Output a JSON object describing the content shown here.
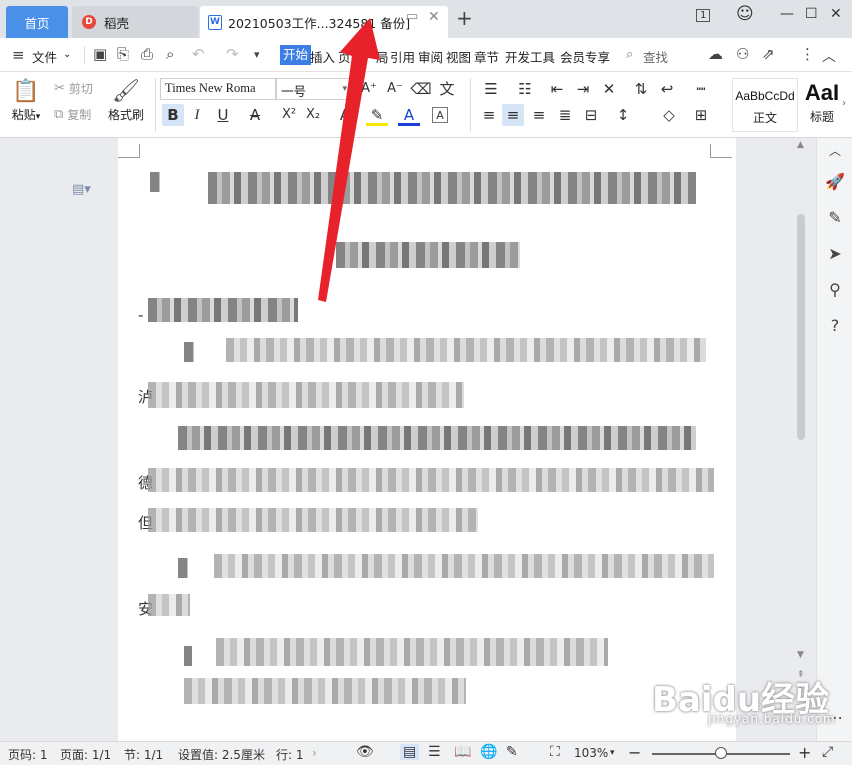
{
  "tabs": {
    "home": "首页",
    "daoke": "稻壳",
    "doc": "20210503工作...324581 备份]"
  },
  "menu": {
    "file": "文件",
    "items": [
      "开始",
      "插入",
      "页面",
      "局",
      "引用",
      "审阅",
      "视图",
      "章节",
      "开发工具",
      "会员专享"
    ],
    "search": "查找"
  },
  "ribbon": {
    "paste": "粘贴",
    "cut": "剪切",
    "copy": "复制",
    "format_painter": "格式刷",
    "font_name": "Times New Roma",
    "font_size": "一号",
    "style_normal_preview": "AaBbCcDd",
    "style_normal": "正文",
    "style_title_preview": "AaI",
    "style_title": "标题"
  },
  "document": {
    "line_stubs": [
      "-",
      "泸",
      "德",
      "但",
      "安"
    ]
  },
  "status": {
    "page_code": "页码: 1",
    "page": "页面: 1/1",
    "section": "节: 1/1",
    "setting": "设置值: 2.5厘米",
    "row": "行: 1",
    "zoom": "103%",
    "zoom_fraction": 0.5
  },
  "watermark": {
    "brand": "Baidu经验",
    "url": "jingyan.baidu.com"
  },
  "colors": {
    "accent": "#3b7ee6",
    "home_tab": "#4a8fe8",
    "arrow": "#e8222b",
    "highlight": "#f5e800",
    "font_color": "#1a3fd6"
  }
}
